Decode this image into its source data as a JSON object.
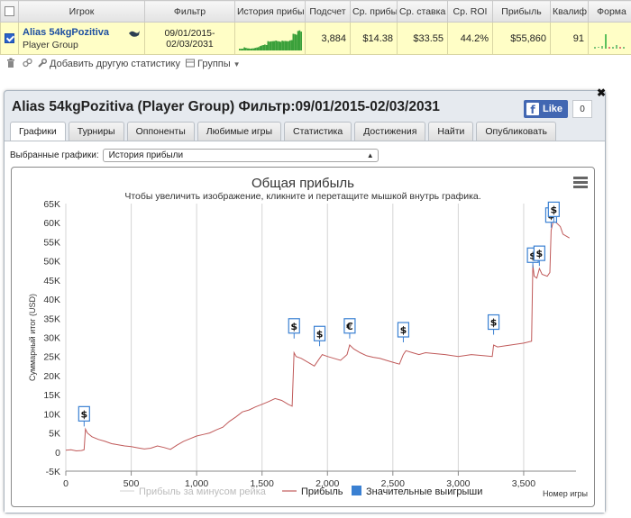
{
  "table": {
    "headers": [
      "",
      "Игрок",
      "Фильтр",
      "История прибы",
      "Подсчет",
      "Ср. прибы",
      "Ср. ставка",
      "Ср. ROI",
      "Прибыль",
      "Квалиф",
      "Форма",
      ""
    ],
    "row": {
      "player_name": "Alias 54kgPozitiva",
      "player_group": "Player Group",
      "filter_line1": "09/01/2015-",
      "filter_line2": "02/03/2031",
      "count": "3,884",
      "avg_profit": "$14.38",
      "avg_stake": "$33.55",
      "avg_roi": "44.2%",
      "profit": "$55,860",
      "qualif": "91",
      "close": "x"
    }
  },
  "toolbar": {
    "add_stats": "Добавить другую статистику",
    "groups": "Группы"
  },
  "panel": {
    "title": "Alias 54kgPozitiva (Player Group) Фильтр:09/01/2015-02/03/2031",
    "like_label": "Like",
    "like_count": "0",
    "tabs": [
      "Графики",
      "Турниры",
      "Оппоненты",
      "Любимые игры",
      "Статистика",
      "Достижения",
      "Найти",
      "Опубликовать"
    ],
    "chart_select_label": "Выбранные графики:",
    "chart_select_value": "История прибыли"
  },
  "chart_data": {
    "type": "line",
    "title": "Общая прибыль",
    "subtitle": "Чтобы увеличить изображение, кликните и перетащите мышкой внутрь графика.",
    "ylabel": "Суммарный итог (USD)",
    "xlabel": "Номер игры",
    "xlim": [
      0,
      3900
    ],
    "ylim": [
      -5000,
      65000
    ],
    "x_ticks": [
      "0",
      "500",
      "1,000",
      "1,500",
      "2,000",
      "2,500",
      "3,000",
      "3,500"
    ],
    "y_ticks": [
      "-5K",
      "0",
      "5K",
      "10K",
      "15K",
      "20K",
      "25K",
      "30K",
      "35K",
      "40K",
      "45K",
      "50K",
      "55K",
      "60K",
      "65K"
    ],
    "legend": [
      "Прибыль за минусом рейка",
      "Прибыль",
      "Значительные выигрыши"
    ],
    "colors": {
      "profit": "#c05a5a",
      "raked": "#d8d8d8",
      "big_wins": "#3a80d2"
    },
    "series": [
      {
        "name": "Прибыль",
        "points": [
          [
            0,
            500
          ],
          [
            40,
            600
          ],
          [
            80,
            300
          ],
          [
            120,
            400
          ],
          [
            140,
            600
          ],
          [
            150,
            6000
          ],
          [
            165,
            5000
          ],
          [
            200,
            4000
          ],
          [
            250,
            3300
          ],
          [
            300,
            2800
          ],
          [
            350,
            2200
          ],
          [
            400,
            1900
          ],
          [
            450,
            1600
          ],
          [
            500,
            1400
          ],
          [
            550,
            1100
          ],
          [
            600,
            800
          ],
          [
            650,
            1000
          ],
          [
            700,
            1600
          ],
          [
            750,
            1200
          ],
          [
            800,
            700
          ],
          [
            850,
            1800
          ],
          [
            900,
            2800
          ],
          [
            950,
            3500
          ],
          [
            1000,
            4200
          ],
          [
            1050,
            4600
          ],
          [
            1100,
            5000
          ],
          [
            1150,
            5800
          ],
          [
            1200,
            6500
          ],
          [
            1250,
            8000
          ],
          [
            1300,
            9200
          ],
          [
            1350,
            10500
          ],
          [
            1400,
            11000
          ],
          [
            1450,
            11800
          ],
          [
            1500,
            12500
          ],
          [
            1550,
            13200
          ],
          [
            1600,
            14000
          ],
          [
            1650,
            13500
          ],
          [
            1700,
            12500
          ],
          [
            1730,
            12000
          ],
          [
            1745,
            26000
          ],
          [
            1760,
            25000
          ],
          [
            1800,
            24500
          ],
          [
            1850,
            23500
          ],
          [
            1900,
            22500
          ],
          [
            1940,
            24500
          ],
          [
            1960,
            25500
          ],
          [
            2000,
            25000
          ],
          [
            2050,
            24500
          ],
          [
            2100,
            24000
          ],
          [
            2150,
            25500
          ],
          [
            2170,
            28000
          ],
          [
            2200,
            27000
          ],
          [
            2250,
            26000
          ],
          [
            2300,
            25200
          ],
          [
            2350,
            24800
          ],
          [
            2400,
            24500
          ],
          [
            2450,
            24000
          ],
          [
            2500,
            23500
          ],
          [
            2550,
            23000
          ],
          [
            2580,
            25500
          ],
          [
            2600,
            26500
          ],
          [
            2650,
            26000
          ],
          [
            2700,
            25500
          ],
          [
            2750,
            26000
          ],
          [
            2800,
            25800
          ],
          [
            2900,
            25500
          ],
          [
            3000,
            25000
          ],
          [
            3100,
            25500
          ],
          [
            3200,
            25200
          ],
          [
            3260,
            25000
          ],
          [
            3270,
            28000
          ],
          [
            3300,
            27500
          ],
          [
            3400,
            28000
          ],
          [
            3500,
            28500
          ],
          [
            3560,
            29000
          ],
          [
            3570,
            49000
          ],
          [
            3580,
            46000
          ],
          [
            3600,
            45500
          ],
          [
            3620,
            48000
          ],
          [
            3640,
            46500
          ],
          [
            3680,
            46000
          ],
          [
            3700,
            47000
          ],
          [
            3710,
            58000
          ],
          [
            3730,
            61000
          ],
          [
            3750,
            60000
          ],
          [
            3780,
            59000
          ],
          [
            3800,
            57000
          ],
          [
            3850,
            56000
          ]
        ]
      }
    ],
    "big_wins": [
      [
        140,
        10000
      ],
      [
        1745,
        33000
      ],
      [
        1940,
        31000
      ],
      [
        2170,
        33000
      ],
      [
        2580,
        32000
      ],
      [
        3270,
        34000
      ],
      [
        3570,
        51500
      ],
      [
        3620,
        52000
      ],
      [
        3710,
        62000
      ],
      [
        3730,
        63500
      ]
    ],
    "big_win_symbols": [
      "$",
      "$",
      "$",
      "€",
      "$",
      "$",
      "$",
      "$",
      "$",
      "$"
    ]
  }
}
